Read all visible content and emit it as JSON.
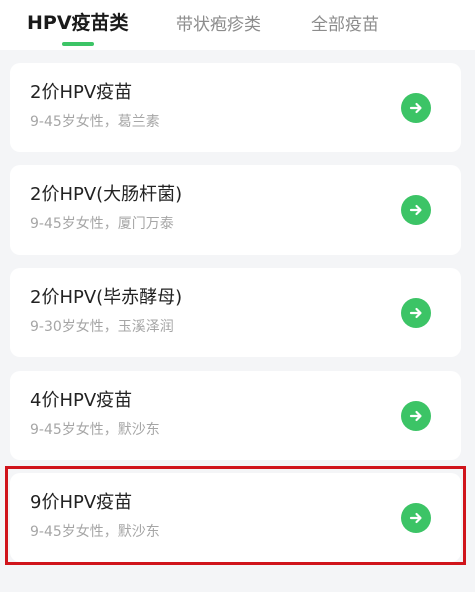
{
  "tabs": [
    {
      "label": "HPV疫苗类",
      "active": true
    },
    {
      "label": "带状疱疹类",
      "active": false
    },
    {
      "label": "全部疫苗",
      "active": false
    }
  ],
  "cards": [
    {
      "title": "2价HPV疫苗",
      "subtitle": "9-45岁女性，葛兰素"
    },
    {
      "title": "2价HPV(大肠杆菌)",
      "subtitle": "9-45岁女性，厦门万泰"
    },
    {
      "title": "2价HPV(毕赤酵母)",
      "subtitle": "9-30岁女性，玉溪泽润"
    },
    {
      "title": "4价HPV疫苗",
      "subtitle": "9-45岁女性，默沙东"
    },
    {
      "title": "9价HPV疫苗",
      "subtitle": "9-45岁女性，默沙东",
      "highlighted": true
    }
  ],
  "colors": {
    "accent_green": "#3cc466",
    "highlight_red": "#d0141b"
  },
  "icons": {
    "card_action": "arrow-right-circle-icon"
  }
}
